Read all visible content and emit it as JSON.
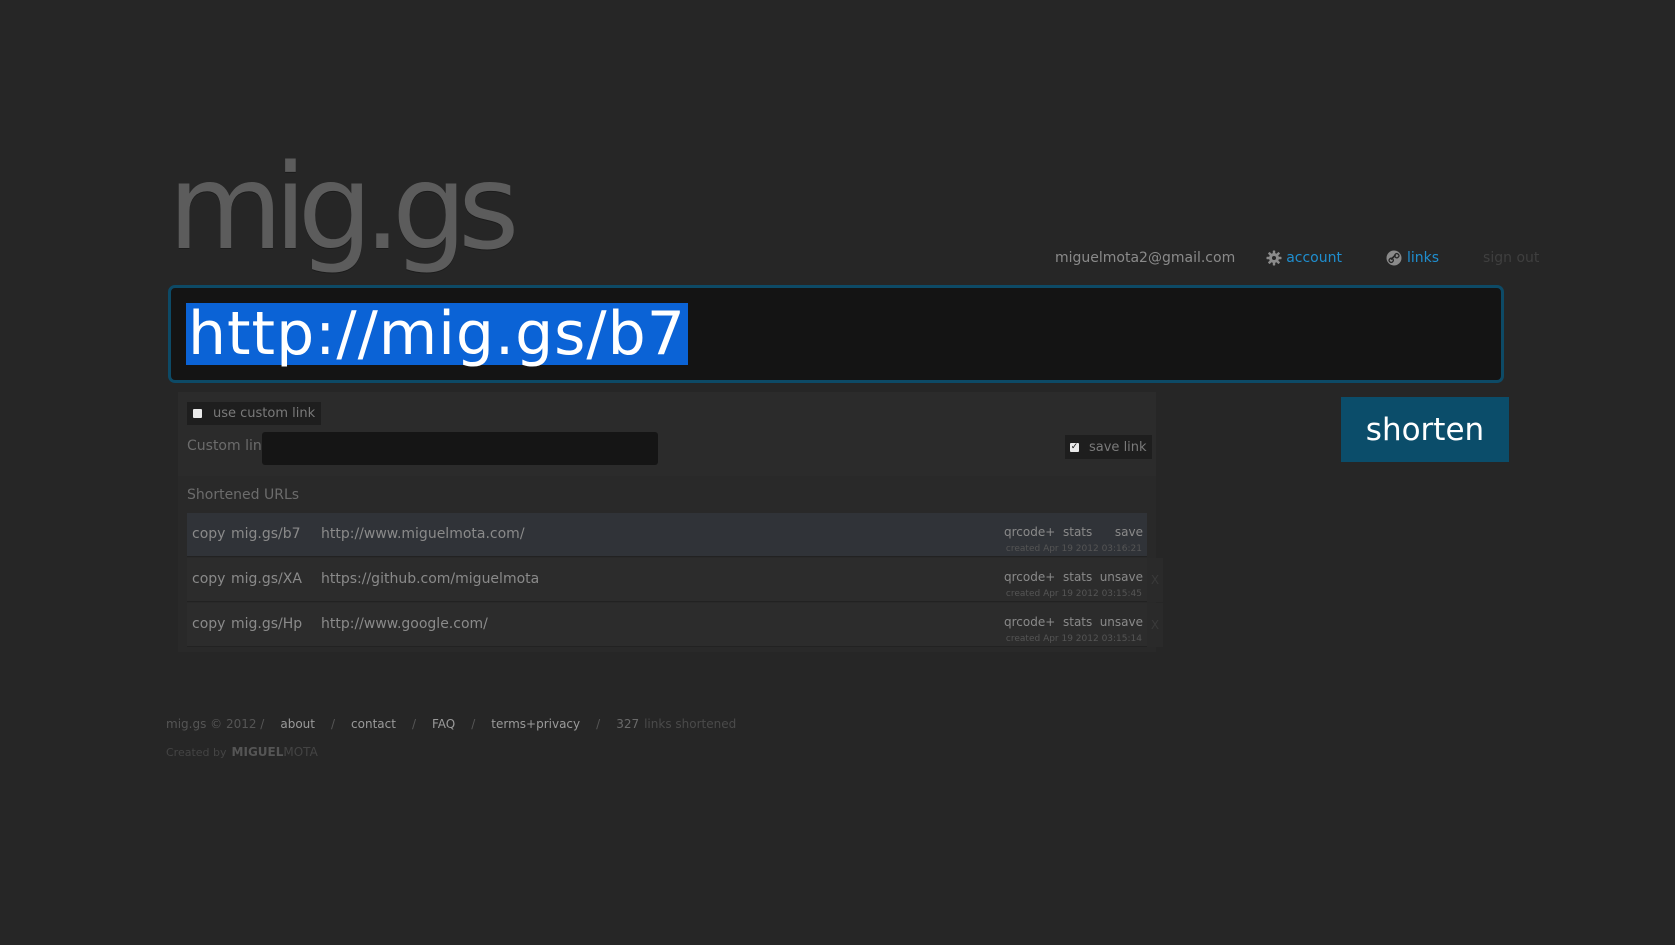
{
  "logo": "mig.gs",
  "topnav": {
    "email": "miguelmota2@gmail.com",
    "account": "account",
    "links": "links",
    "signout": "sign out",
    "account_icon": "gear-icon",
    "links_icon": "link-icon"
  },
  "url_input": {
    "value": "http://mig.gs/b7"
  },
  "shorten_label": "shorten",
  "options": {
    "use_custom_link": "use custom link",
    "custom_link_label": "Custom link",
    "save_link": "save link"
  },
  "shortened_title": "Shortened URLs",
  "rows": [
    {
      "copy": "copy",
      "short": "mig.gs/b7",
      "long": "http://www.miguelmota.com/",
      "qrcode": "qrcode+",
      "stats": "stats",
      "save": "save",
      "created": "created Apr 19 2012 03:16:21",
      "x": ""
    },
    {
      "copy": "copy",
      "short": "mig.gs/XA",
      "long": "https://github.com/miguelmota",
      "qrcode": "qrcode+",
      "stats": "stats",
      "save": "unsave",
      "created": "created Apr 19 2012 03:15:45",
      "x": "X"
    },
    {
      "copy": "copy",
      "short": "mig.gs/Hp",
      "long": "http://www.google.com/",
      "qrcode": "qrcode+",
      "stats": "stats",
      "save": "unsave",
      "created": "created Apr 19 2012 03:15:14",
      "x": "X"
    }
  ],
  "footer": {
    "copyright": "mig.gs © 2012 /",
    "about": "about",
    "contact": "contact",
    "faq": "FAQ",
    "terms": "terms+privacy",
    "sep": "/",
    "count": "327",
    "count_text": "links shortened",
    "created_by": "Created by",
    "author_first": "MIGUEL",
    "author_last": "MOTA"
  },
  "colors": {
    "background": "#262626",
    "accent": "#0b4d6a",
    "link": "#1f8ecf",
    "selection": "#0b63d6"
  }
}
